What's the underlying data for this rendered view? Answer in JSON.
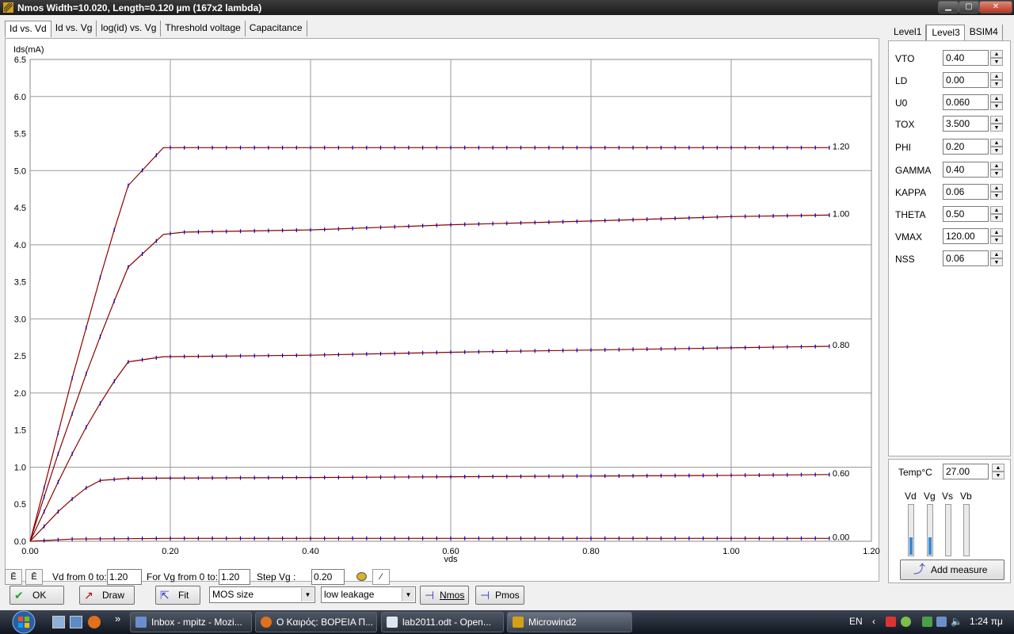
{
  "window": {
    "title": "Nmos Width=10.020, Length=0.120 µm (167x2 lambda)",
    "min": "0",
    "max": "1",
    "close": "r"
  },
  "tabs": [
    {
      "label": "Id vs. Vd",
      "active": true
    },
    {
      "label": "Id vs. Vg",
      "active": false
    },
    {
      "label": "log(id) vs. Vg",
      "active": false
    },
    {
      "label": "Threshold voltage",
      "active": false
    },
    {
      "label": "Capacitance",
      "active": false
    }
  ],
  "chart_data": {
    "type": "line",
    "xlabel": "vds",
    "ylabel": "Ids(mA)",
    "xlim": [
      0,
      1.2
    ],
    "ylim": [
      0,
      6.5
    ],
    "x_ticks": [
      "0.00",
      "0.20",
      "0.40",
      "0.60",
      "0.80",
      "1.00",
      "1.20"
    ],
    "y_ticks": [
      "0.0",
      "0.5",
      "1.0",
      "1.5",
      "2.0",
      "2.5",
      "3.0",
      "3.5",
      "4.0",
      "4.5",
      "5.0",
      "5.5",
      "6.0",
      "6.5"
    ],
    "grid": true,
    "colors": {
      "line": "#8b0000",
      "marker": "#0000cc"
    },
    "series": [
      {
        "name": "1.20",
        "points": [
          [
            0,
            0
          ],
          [
            0.02,
            0.72
          ],
          [
            0.04,
            1.46
          ],
          [
            0.06,
            2.2
          ],
          [
            0.08,
            2.88
          ],
          [
            0.1,
            3.56
          ],
          [
            0.12,
            4.2
          ],
          [
            0.14,
            4.8
          ],
          [
            0.19,
            5.31
          ],
          [
            1.14,
            5.31
          ]
        ]
      },
      {
        "name": "1.00",
        "points": [
          [
            0,
            0
          ],
          [
            0.02,
            0.6
          ],
          [
            0.04,
            1.18
          ],
          [
            0.06,
            1.72
          ],
          [
            0.08,
            2.26
          ],
          [
            0.1,
            2.76
          ],
          [
            0.12,
            3.24
          ],
          [
            0.14,
            3.7
          ],
          [
            0.19,
            4.14
          ],
          [
            0.22,
            4.17
          ],
          [
            0.4,
            4.2
          ],
          [
            0.6,
            4.27
          ],
          [
            0.8,
            4.32
          ],
          [
            1.0,
            4.38
          ],
          [
            1.14,
            4.4
          ]
        ]
      },
      {
        "name": "0.80",
        "points": [
          [
            0,
            0
          ],
          [
            0.02,
            0.4
          ],
          [
            0.04,
            0.8
          ],
          [
            0.06,
            1.18
          ],
          [
            0.08,
            1.54
          ],
          [
            0.1,
            1.86
          ],
          [
            0.12,
            2.16
          ],
          [
            0.14,
            2.42
          ],
          [
            0.19,
            2.49
          ],
          [
            0.4,
            2.51
          ],
          [
            0.6,
            2.55
          ],
          [
            0.8,
            2.58
          ],
          [
            1.0,
            2.61
          ],
          [
            1.14,
            2.63
          ]
        ]
      },
      {
        "name": "0.60",
        "points": [
          [
            0,
            0
          ],
          [
            0.02,
            0.2
          ],
          [
            0.04,
            0.4
          ],
          [
            0.06,
            0.57
          ],
          [
            0.08,
            0.72
          ],
          [
            0.1,
            0.82
          ],
          [
            0.14,
            0.85
          ],
          [
            0.4,
            0.86
          ],
          [
            0.6,
            0.87
          ],
          [
            0.8,
            0.88
          ],
          [
            1.0,
            0.89
          ],
          [
            1.14,
            0.9
          ]
        ]
      },
      {
        "name": "0.00",
        "points": [
          [
            0,
            0
          ],
          [
            0.02,
            0.01
          ],
          [
            0.06,
            0.03
          ],
          [
            0.2,
            0.04
          ],
          [
            1.14,
            0.04
          ]
        ]
      }
    ]
  },
  "controls": {
    "vd_label": "Vd from 0 to:",
    "vd_value": "1.20",
    "vg_label": "For Vg from 0 to:",
    "vg_value": "1.20",
    "step_label": "Step Vg :",
    "step_value": "0.20"
  },
  "buttons": {
    "ok": "OK",
    "draw": "Draw",
    "fit": "Fit",
    "nmos": "Nmos",
    "pmos": "Pmos",
    "add_measure": "Add measure"
  },
  "selects": {
    "size": "MOS size",
    "leakage": "low leakage"
  },
  "right_tabs": [
    {
      "label": "Level1",
      "active": false
    },
    {
      "label": "Level3",
      "active": true
    },
    {
      "label": "BSIM4",
      "active": false
    }
  ],
  "params": [
    {
      "name": "VTO",
      "value": "0.40"
    },
    {
      "name": "LD",
      "value": "0.00"
    },
    {
      "name": "U0",
      "value": "0.060"
    },
    {
      "name": "TOX",
      "value": "3.500"
    },
    {
      "name": "PHI",
      "value": "0.20"
    },
    {
      "name": "GAMMA",
      "value": "0.40"
    },
    {
      "name": "KAPPA",
      "value": "0.06"
    },
    {
      "name": "THETA",
      "value": "0.50"
    },
    {
      "name": "VMAX",
      "value": "120.00"
    },
    {
      "name": "NSS",
      "value": "0.06"
    }
  ],
  "temperature": {
    "label": "Temp°C",
    "value": "27.00"
  },
  "voltage_sliders": [
    {
      "label": "Vd",
      "level": 0.35
    },
    {
      "label": "Vg",
      "level": 0.35
    },
    {
      "label": "Vs",
      "level": 0
    },
    {
      "label": "Vb",
      "level": 0
    }
  ],
  "taskbar": {
    "items": [
      {
        "label": "Inbox - mpitz - Mozi...",
        "active": false
      },
      {
        "label": "Ο Καιρός: ΒΟΡΕΙΑ Π...",
        "active": false
      },
      {
        "label": "lab2011.odt - Open...",
        "active": false
      },
      {
        "label": "Microwind2",
        "active": true
      }
    ],
    "lang": "EN",
    "clock": "1:24 πμ",
    "overflow": "»"
  }
}
